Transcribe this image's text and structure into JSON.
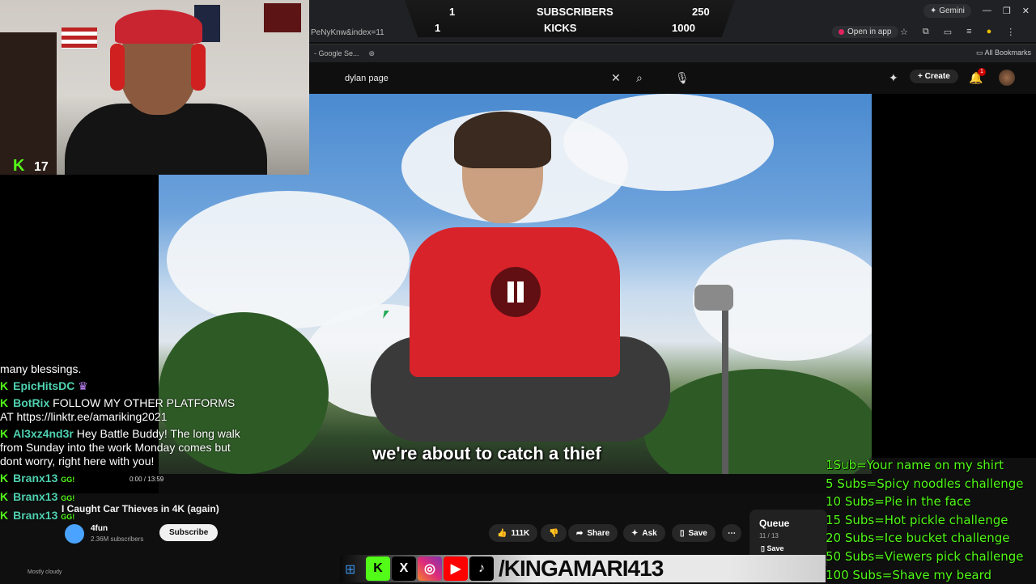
{
  "scoreboard": {
    "row1": {
      "left": "1",
      "label": "SUBSCRIBERS",
      "right": "250"
    },
    "row2": {
      "left": "1",
      "label": "KICKS",
      "right": "1000"
    }
  },
  "browser": {
    "url_fragment": "PeNyKnw&index=11",
    "gemini_label": "Gemini",
    "open_in_app_label": "Open in app",
    "bookmark_item": "- Google Se...",
    "all_bookmarks_label": "All Bookmarks"
  },
  "youtube": {
    "search_value": "dylan page",
    "create_label": "Create",
    "notification_count": "1"
  },
  "video": {
    "caption": "we're about to catch a thief",
    "title": "I Caught Car Thieves in 4K (again)",
    "time": "0:00 / 13:59",
    "channel_name": "4fun",
    "channel_subscribers": "2.36M subscribers",
    "subscribe_label": "Subscribe",
    "likes": "111K",
    "share_label": "Share",
    "ask_label": "Ask",
    "save_label": "Save"
  },
  "queue": {
    "title": "Queue",
    "count": "11 / 13",
    "save_label": "Save"
  },
  "webcam": {
    "kick_count": "17"
  },
  "chat": [
    {
      "user": "",
      "text": "many blessings."
    },
    {
      "user": "EpicHitsDC",
      "text": ""
    },
    {
      "user": "BotRix",
      "text": "FOLLOW MY OTHER PLATFORMS AT https://linktr.ee/amariking2021"
    },
    {
      "user": "Al3xz4nd3r",
      "text": "Hey Battle Buddy! The long walk from Sunday into the work Monday comes but dont worry, right here with you!"
    },
    {
      "user": "Branx13",
      "text": "GG!"
    },
    {
      "user": "Branx13",
      "text": "GG!"
    },
    {
      "user": "Branx13",
      "text": "GG!"
    }
  ],
  "weather": "Mostly cloudy",
  "social_handle": "/KINGAMARI413",
  "sub_goals": [
    "1Sub=Your name on my shirt",
    "5 Subs=Spicy noodles challenge",
    "10 Subs=Pie in the face",
    "15 Subs=Hot pickle challenge",
    "20 Subs=Ice bucket challenge",
    "50 Subs=Viewers pick challenge",
    "100 Subs=Shave my beard"
  ],
  "colors": {
    "kick_green": "#53fc18",
    "youtube_red": "#cc0000",
    "shirt_red": "#d8232a"
  }
}
